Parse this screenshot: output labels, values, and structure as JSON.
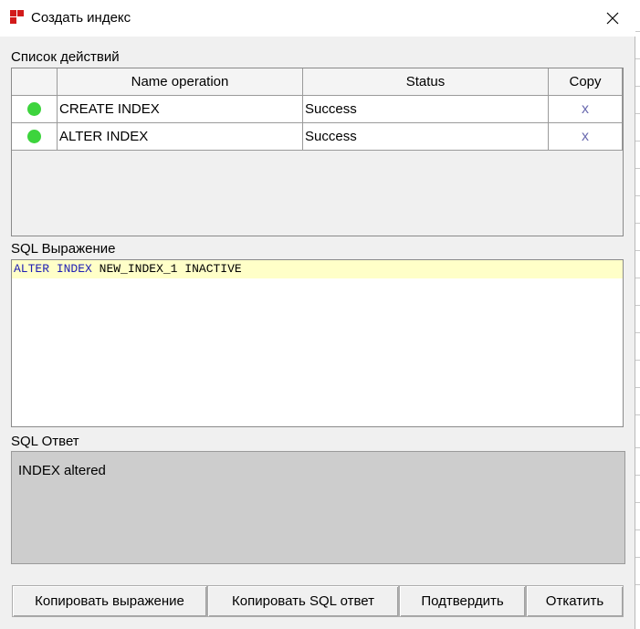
{
  "window": {
    "title": "Создать индекс"
  },
  "actions": {
    "label": "Список действий",
    "columns": [
      "Name operation",
      "Status",
      "Copy"
    ],
    "rows": [
      {
        "operation": "CREATE INDEX",
        "status": "Success",
        "copy": "x",
        "indicator": "#3dd43d"
      },
      {
        "operation": "ALTER INDEX",
        "status": "Success",
        "copy": "x",
        "indicator": "#3dd43d"
      }
    ]
  },
  "sql_expression": {
    "label": "SQL Выражение",
    "tokens": [
      "ALTER",
      "INDEX",
      "NEW_INDEX_1",
      "INACTIVE"
    ]
  },
  "sql_answer": {
    "label": "SQL Ответ",
    "text": "INDEX altered"
  },
  "buttons": {
    "copy_expression": "Копировать выражение",
    "copy_sql_answer": "Копировать SQL ответ",
    "confirm": "Подтвердить",
    "rollback": "Откатить"
  },
  "colors": {
    "success_dot": "#3dd43d",
    "keyword": "#1e1eb4",
    "current_line": "#ffffc8",
    "app_icon": "#d21a1a"
  }
}
